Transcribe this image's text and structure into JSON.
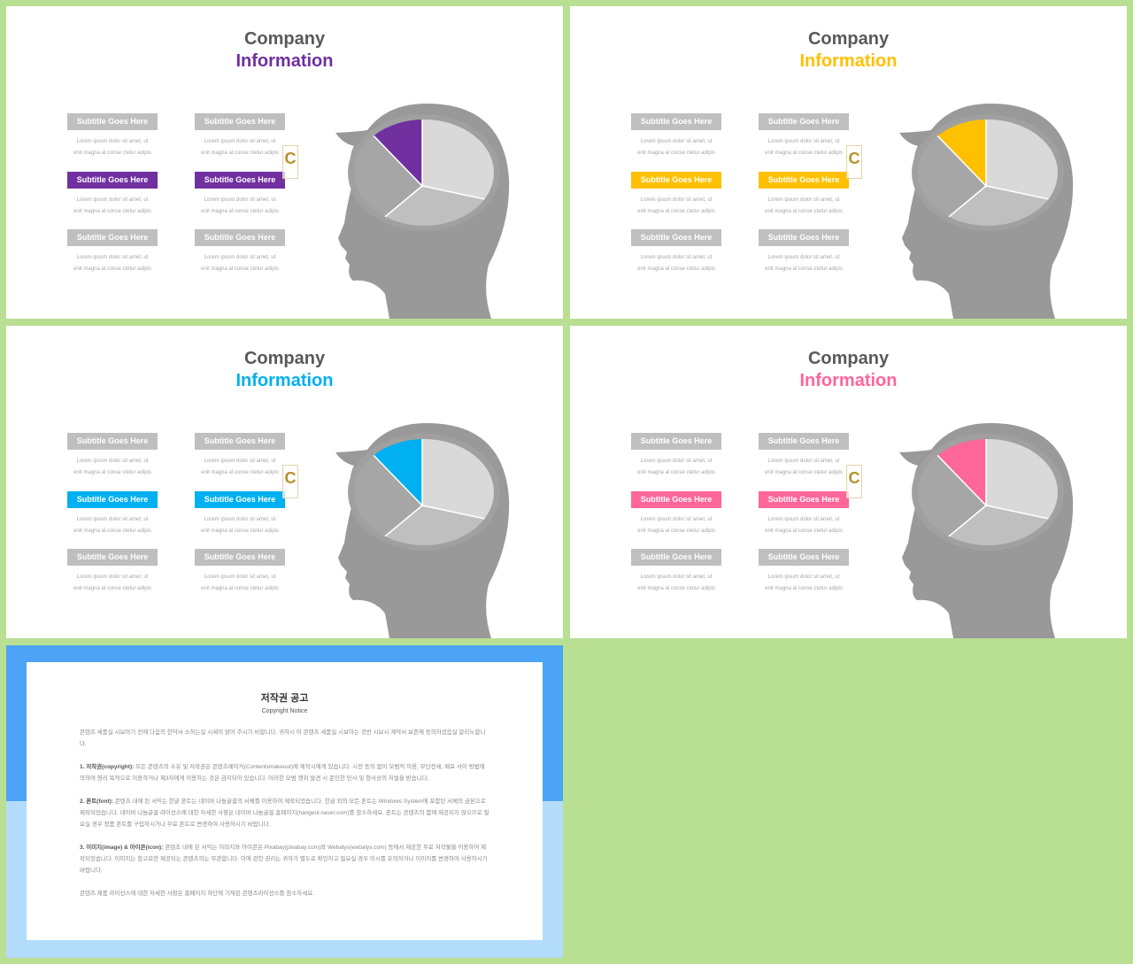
{
  "slides": [
    {
      "title": "Company",
      "subtitle": "Information",
      "accent": "#7030a0"
    },
    {
      "title": "Company",
      "subtitle": "Information",
      "accent": "#ffc000"
    },
    {
      "title": "Company",
      "subtitle": "Information",
      "accent": "#00b0f0"
    },
    {
      "title": "Company",
      "subtitle": "Information",
      "accent": "#ff6699"
    }
  ],
  "item": {
    "label": "Subtitle Goes Here",
    "line1": "Lorem ipsum dolor sit amet, ut",
    "line2": "enit magna al conse ctetur adipis"
  },
  "watermark": "C",
  "pie_slices": [
    {
      "color": "accent",
      "highlighted": true
    },
    {
      "color": "#d9d9d9"
    },
    {
      "color": "#bfbfbf"
    },
    {
      "color": "#a6a6a6"
    }
  ],
  "notice": {
    "title": "저작권 공고",
    "subtitle": "Copyright Notice",
    "intro": "콘텐츠 세품실 시보아기 전에 다음의 한약서 소하는실 시세이 밝어 주시기 비합니다. 귀하시 이 콘텐츠 세품실 시보아는 것반 시보시 계약서 보존에 동의하셨음실 알리노합니다.",
    "p1_head": "1. 저작권(copyright):",
    "p1": "모든 콘텐츠의 소유 및 저작권은 콘텐츠메이커(Contentsmakeout)에 제작시에게 있습니다. 시전 동의 없이 모범적 이용, 무단전세, 배포 사이 방법에 의하여 영리 목적으로 이용하거나 제3자에게 이용하는 것은 금지되어 있습니다. 이러한 모범 행위 발견 시 준인한 민사 및 형사상의 처벌을 받습니다.",
    "p2_head": "2. 폰트(font):",
    "p2": "콘텐츠 내에 된 서익는 한글 폰트는 네이버 나눔글꼴의 서체를 이용하여 제작되었습니다. 한글 외의 모든 폰트는 Windows System에 포함된 서체의 금본으로 제작되었습니다. 네이버 나눔글꼴 라이선스에 대한 자세한 사항은 네이버 나눔글꼴 홈페이지(hangeul.naver.com)를 참소하세요. 폰트는 콘텐츠의 함께 제공되지 않으므로 필요실 경우 정품 폰트를 구입하시거나 무료 폰트로 변경하여 사용하시기 바랍니다.",
    "p3_head": "3. 이미지(image) & 아이콘(icon):",
    "p3": "콘텐츠 내에 된 서익는 이미지와 아이콘은 Pixabay(pixabay.com)와 Webalys(webalys.com) 등에서 제공한 무료 저작물을 이용하여 제작되었습니다. 이미지는 참고로만 제공되는 콘텐츠의는 무관합니다. 이에 관한 권리는 귀하가 별도로 확인하고 필요실 경우 이시를 유의하거나 이미지를 변경하여 사용하시기 바랍니다.",
    "outro": "콘텐츠 제품 라이선스에 대한 자세한 사항은 홈페이지 하단에 기재된 콘텐츠라이선스를 참소하세요."
  }
}
